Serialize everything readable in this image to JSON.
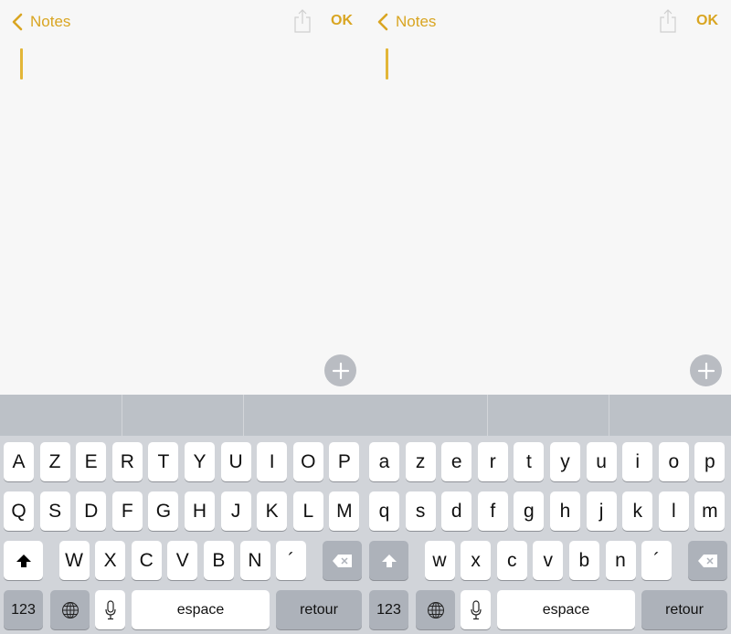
{
  "colors": {
    "accent": "#d9a521",
    "keyboard_bg": "#d1d4d9",
    "key_bg": "#ffffff",
    "special_key_bg": "#adb2ba",
    "suggestion_bar": "#bcc1c7",
    "note_bg": "#f7f7f7"
  },
  "screens": [
    {
      "id": "uppercase",
      "navbar": {
        "back_label": "Notes",
        "back_icon": "chevron-left-icon",
        "share_icon": "share-icon",
        "ok_label": "OK"
      },
      "note": {
        "text": ""
      },
      "add_button_icon": "plus-icon",
      "suggestions": [
        "",
        "",
        ""
      ],
      "keyboard": {
        "shift_active": true,
        "row1": [
          "A",
          "Z",
          "E",
          "R",
          "T",
          "Y",
          "U",
          "I",
          "O",
          "P"
        ],
        "row2": [
          "Q",
          "S",
          "D",
          "F",
          "G",
          "H",
          "J",
          "K",
          "L",
          "M"
        ],
        "row3": [
          "W",
          "X",
          "C",
          "V",
          "B",
          "N",
          "´"
        ],
        "shift_icon": "shift-icon",
        "delete_icon": "delete-icon",
        "numbers_label": "123",
        "globe_icon": "globe-icon",
        "mic_icon": "microphone-icon",
        "space_label": "espace",
        "return_label": "retour"
      }
    },
    {
      "id": "lowercase",
      "navbar": {
        "back_label": "Notes",
        "back_icon": "chevron-left-icon",
        "share_icon": "share-icon",
        "ok_label": "OK"
      },
      "note": {
        "text": ""
      },
      "add_button_icon": "plus-icon",
      "suggestions": [
        "",
        "",
        ""
      ],
      "keyboard": {
        "shift_active": false,
        "row1": [
          "a",
          "z",
          "e",
          "r",
          "t",
          "y",
          "u",
          "i",
          "o",
          "p"
        ],
        "row2": [
          "q",
          "s",
          "d",
          "f",
          "g",
          "h",
          "j",
          "k",
          "l",
          "m"
        ],
        "row3": [
          "w",
          "x",
          "c",
          "v",
          "b",
          "n",
          "´"
        ],
        "shift_icon": "shift-icon",
        "delete_icon": "delete-icon",
        "numbers_label": "123",
        "globe_icon": "globe-icon",
        "mic_icon": "microphone-icon",
        "space_label": "espace",
        "return_label": "retour"
      }
    }
  ]
}
